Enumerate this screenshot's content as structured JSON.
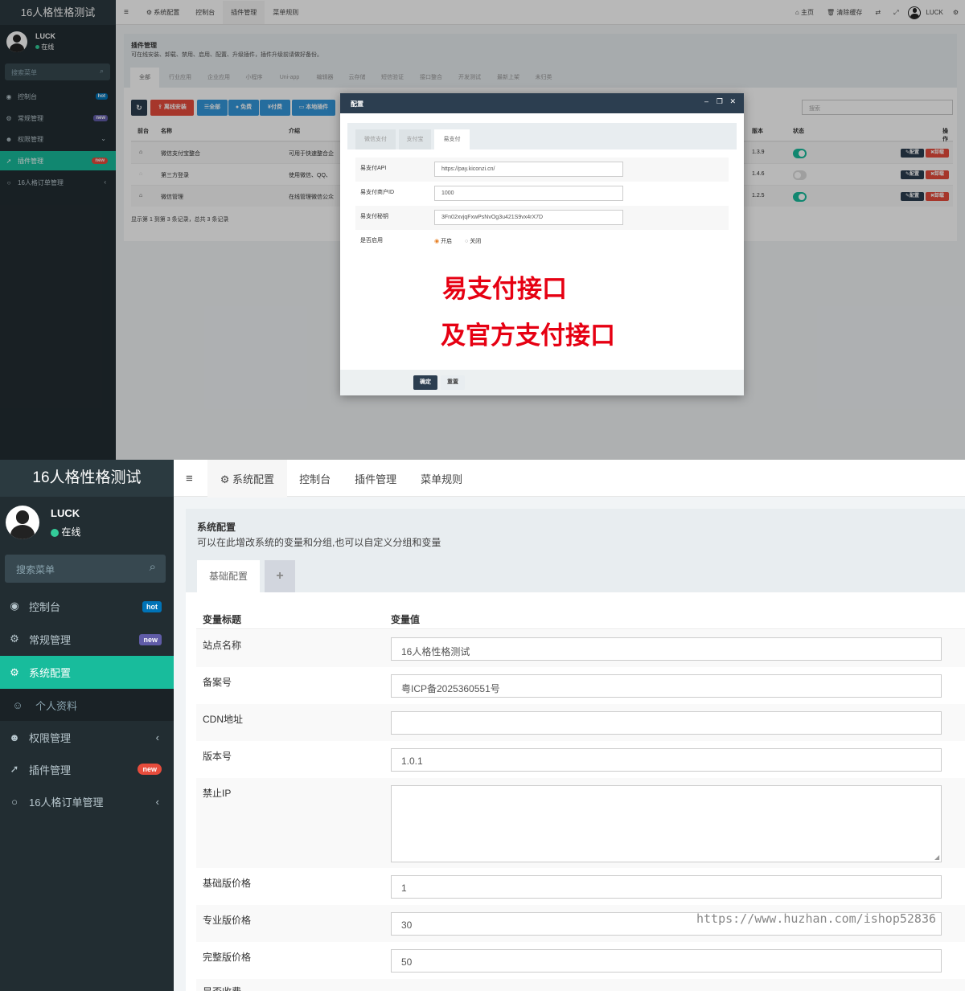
{
  "app": {
    "title": "16人格性格测试"
  },
  "user": {
    "name": "LUCK",
    "status": "在线"
  },
  "sidebar": {
    "search_placeholder": "搜索菜单",
    "items": [
      {
        "label": "控制台",
        "icon": "dashboard-icon",
        "badge": "hot"
      },
      {
        "label": "常规管理",
        "icon": "cogs-icon",
        "badge": "new"
      },
      {
        "label": "权限管理",
        "icon": "users-icon"
      },
      {
        "label": "插件管理",
        "icon": "rocket-icon",
        "badge": "new"
      },
      {
        "label": "16人格订单管理",
        "icon": "circle-icon"
      },
      {
        "label": "系统配置",
        "icon": "gear-icon"
      },
      {
        "label": "个人资料",
        "icon": "user-icon"
      }
    ]
  },
  "topnav": {
    "items": [
      "系统配置",
      "控制台",
      "插件管理",
      "菜单规则"
    ],
    "home": "主页",
    "clear_cache": "清除缓存",
    "user": "LUCK"
  },
  "plugin": {
    "title": "插件管理",
    "desc": "可在线安装、卸载、禁用、启用、配置、升级插件，插件升级前请做好备份。",
    "tabs": [
      "全部",
      "行业应用",
      "企业应用",
      "小程序",
      "Uni-app",
      "编辑器",
      "云存储",
      "短信验证",
      "接口整合",
      "开发测试",
      "最新上架",
      "未归类"
    ],
    "toolbar": {
      "offline": "离线安装",
      "all": "全部",
      "free": "免费",
      "paid": "付费",
      "local": "本地插件",
      "search_placeholder": "搜索"
    },
    "columns": [
      "前台",
      "名称",
      "介绍",
      "版本",
      "状态",
      "操作"
    ],
    "rows": [
      {
        "name": "微信支付宝整合",
        "intro": "可用于快速整合企",
        "version": "1.3.9",
        "enabled": true
      },
      {
        "name": "第三方登录",
        "intro": "使用微信、QQ、",
        "version": "1.4.6",
        "enabled": false
      },
      {
        "name": "微信管理",
        "intro": "在线管理微信公众",
        "version": "1.2.5",
        "enabled": true
      }
    ],
    "action_config": "配置",
    "action_uninstall": "卸载",
    "footer": "显示第 1 到第 3 条记录，总共 3 条记录"
  },
  "modal": {
    "title": "配置",
    "tabs": [
      "微信支付",
      "支付宝",
      "易支付"
    ],
    "fields": [
      {
        "label": "易支付API",
        "value": "https://pay.kiconzi.cn/"
      },
      {
        "label": "易支付商户ID",
        "value": "1000"
      },
      {
        "label": "易支付秘钥",
        "value": "3Fn02xvjqFxwPsNvOg3u421S9vx4rX7D"
      }
    ],
    "enable_label": "是否启用",
    "enable_on": "开启",
    "enable_off": "关闭",
    "promo_line1": "易支付接口",
    "promo_line2": "及官方支付接口",
    "ok": "确定",
    "reset": "重置"
  },
  "config": {
    "title": "系统配置",
    "desc": "可以在此增改系统的变量和分组,也可以自定义分组和变量",
    "tab": "基础配置",
    "add_tab": "+",
    "col_title": "变量标题",
    "col_value": "变量值",
    "rows": [
      {
        "label": "站点名称",
        "value": "16人格性格测试"
      },
      {
        "label": "备案号",
        "value": "粤ICP备2025360551号"
      },
      {
        "label": "CDN地址",
        "value": ""
      },
      {
        "label": "版本号",
        "value": "1.0.1"
      },
      {
        "label": "禁止IP",
        "value": ""
      },
      {
        "label": "基础版价格",
        "value": "1"
      },
      {
        "label": "专业版价格",
        "value": "30"
      },
      {
        "label": "完整版价格",
        "value": "50"
      },
      {
        "label": "是否收费",
        "value": ""
      }
    ]
  },
  "watermark": "https://www.huzhan.com/ishop52836",
  "colors": {
    "sidebar": "#222d32",
    "accent": "#18bc9c",
    "danger": "#e74c3c",
    "primary": "#2c3e50",
    "blue": "#3498db"
  }
}
